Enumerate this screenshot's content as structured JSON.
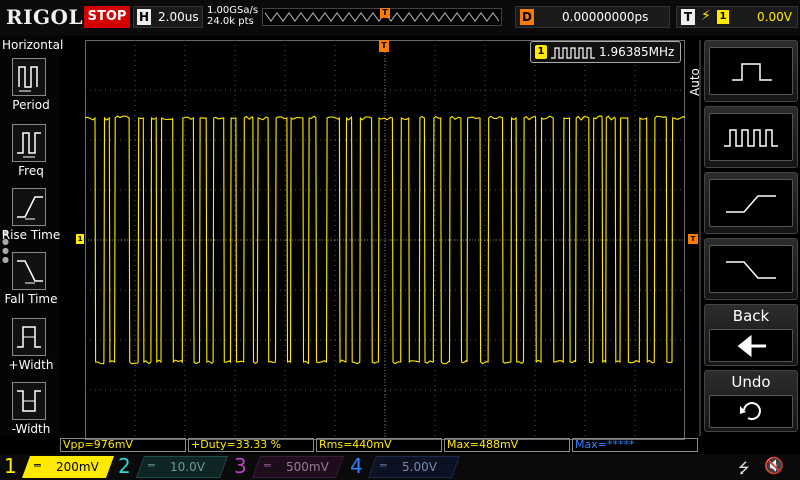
{
  "topbar": {
    "logo": "RIGOL",
    "run_state": "STOP",
    "horizontal_key": "H",
    "timebase": "2.00us",
    "sample_rate": "1.00GSa/s",
    "memory_depth": "24.0k pts",
    "delay_key": "D",
    "delay_value": "0.00000000ps",
    "trigger_key": "T",
    "trigger_channel": "1",
    "trigger_level": "0.00V"
  },
  "left_menu": {
    "title": "Horizontal",
    "items": [
      {
        "label": "Period",
        "icon": "period-icon"
      },
      {
        "label": "Freq",
        "icon": "frequency-icon"
      },
      {
        "label": "Rise Time",
        "icon": "rise-time-icon"
      },
      {
        "label": "Fall Time",
        "icon": "fall-time-icon"
      },
      {
        "label": "+Width",
        "icon": "positive-width-icon"
      },
      {
        "label": "-Width",
        "icon": "negative-width-icon"
      }
    ]
  },
  "measurement_box": {
    "channel": "1",
    "value": "1.96385MHz"
  },
  "right_menu": {
    "mode_label": "Auto",
    "keys": [
      {
        "icon": "single-pulse-icon"
      },
      {
        "icon": "pulse-train-icon"
      },
      {
        "icon": "rising-edge-icon"
      },
      {
        "icon": "falling-edge-icon"
      },
      {
        "label": "Back",
        "icon": "left-arrow-icon"
      },
      {
        "label": "Undo",
        "icon": "undo-icon"
      }
    ]
  },
  "measurements": [
    {
      "text": "Vpp=976mV"
    },
    {
      "text": "+Duty=33.33 %"
    },
    {
      "text": "Rms=440mV"
    },
    {
      "text": "Max=488mV"
    },
    {
      "text": "Max=*****"
    }
  ],
  "channels": [
    {
      "num": "1",
      "scale": "200mV",
      "color": "#ffea00"
    },
    {
      "num": "2",
      "scale": "10.0V",
      "color": "#2bd6d6"
    },
    {
      "num": "3",
      "scale": "500mV",
      "color": "#c040c0"
    },
    {
      "num": "4",
      "scale": "5.00V",
      "color": "#3080ff"
    }
  ],
  "colors": {
    "ch1": "#ffea00",
    "trigger": "#ff7a00",
    "stop": "#d40000"
  },
  "waveform": {
    "channel": "1",
    "high_level_mv": 488,
    "low_level_mv": -488,
    "frequency": "1.96385MHz",
    "duty": "33.33 %"
  }
}
